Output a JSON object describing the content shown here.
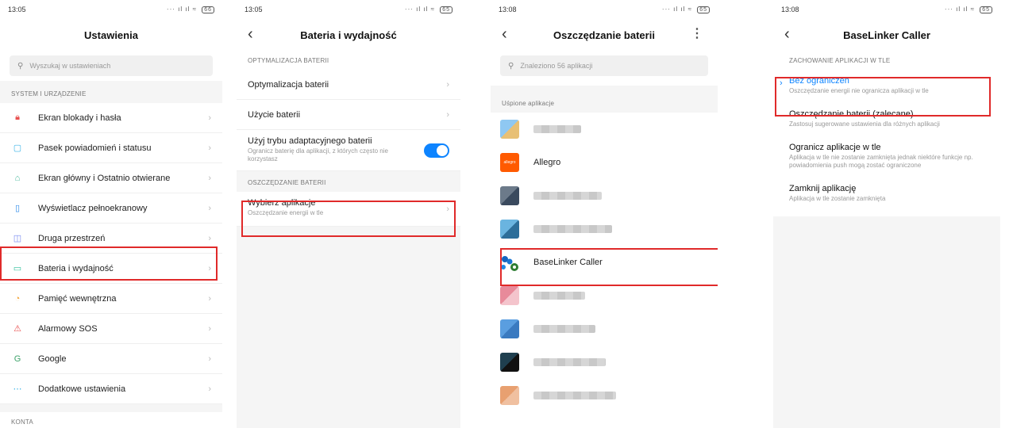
{
  "screen1": {
    "time": "13:05",
    "battery": "66",
    "title": "Ustawienia",
    "search_placeholder": "Wyszukaj w ustawieniach",
    "section_system": "SYSTEM I URZĄDZENIE",
    "items": [
      {
        "label": "Ekran blokady i hasła",
        "icon": "lock-icon",
        "color": "#e8504f"
      },
      {
        "label": "Pasek powiadomień i statusu",
        "icon": "notification-icon",
        "color": "#3fb5e8"
      },
      {
        "label": "Ekran główny i Ostatnio otwierane",
        "icon": "home-icon",
        "color": "#46b89a"
      },
      {
        "label": "Wyświetlacz pełnoekranowy",
        "icon": "fullscreen-icon",
        "color": "#2f8be8"
      },
      {
        "label": "Druga przestrzeń",
        "icon": "second-space-icon",
        "color": "#7a8cf0"
      },
      {
        "label": "Bateria i wydajność",
        "icon": "battery-icon",
        "color": "#33c19d"
      },
      {
        "label": "Pamięć wewnętrzna",
        "icon": "storage-icon",
        "color": "#f2a53a"
      },
      {
        "label": "Alarmowy SOS",
        "icon": "sos-icon",
        "color": "#e8504f"
      },
      {
        "label": "Google",
        "icon": "google-icon",
        "color": "#3fa36b"
      },
      {
        "label": "Dodatkowe ustawienia",
        "icon": "more-dots-icon",
        "color": "#3fb5e8"
      }
    ],
    "section_accounts": "KONTA"
  },
  "screen2": {
    "time": "13:05",
    "battery": "65",
    "title": "Bateria i wydajność",
    "section_opt": "OPTYMALIZACJA BATERII",
    "row_opt": "Optymalizacja baterii",
    "row_usage": "Użycie baterii",
    "row_adaptive": "Użyj trybu adaptacyjnego baterii",
    "row_adaptive_sub": "Ogranicz baterię dla aplikacji, z których często nie korzystasz",
    "adaptive_on": true,
    "section_save": "OSZCZĘDZANIE BATERII",
    "row_choose": "Wybierz aplikacje",
    "row_choose_sub": "Oszczędzanie energii w tle"
  },
  "screen3": {
    "time": "13:08",
    "battery": "65",
    "title": "Oszczędzanie baterii",
    "search_placeholder": "Znaleziono 56 aplikacji",
    "section_sleeping": "Uśpione aplikacje",
    "apps": [
      {
        "name": "",
        "blurred": true
      },
      {
        "name": "Allegro",
        "blurred": false
      },
      {
        "name": "",
        "blurred": true
      },
      {
        "name": "",
        "blurred": true
      },
      {
        "name": "BaseLinker Caller",
        "blurred": false
      },
      {
        "name": "",
        "blurred": true
      },
      {
        "name": "",
        "blurred": true
      },
      {
        "name": "",
        "blurred": true
      },
      {
        "name": "",
        "blurred": true
      }
    ],
    "allegro_logo_text": "allegro"
  },
  "screen4": {
    "time": "13:08",
    "battery": "65",
    "title": "BaseLinker Caller",
    "section": "ZACHOWANIE APLIKACJI W TLE",
    "options": [
      {
        "title": "Bez ograniczeń",
        "sub": "Oszczędzanie energii nie ogranicza aplikacji w tle",
        "selected": true
      },
      {
        "title": "Oszczędzanie baterii (zalecane)",
        "sub": "Zastosuj sugerowane ustawienia dla różnych aplikacji",
        "selected": false
      },
      {
        "title": "Ogranicz aplikacje w tle",
        "sub": "Aplikacja w tle nie zostanie zamknięta jednak niektóre funkcje np. powiadomienia push mogą zostać ograniczone",
        "selected": false
      },
      {
        "title": "Zamknij aplikację",
        "sub": "Aplikacja w tle zostanie zamknięta",
        "selected": false
      }
    ]
  },
  "colors": {
    "accent": "#0d84ff",
    "highlight": "#e02a2a"
  }
}
